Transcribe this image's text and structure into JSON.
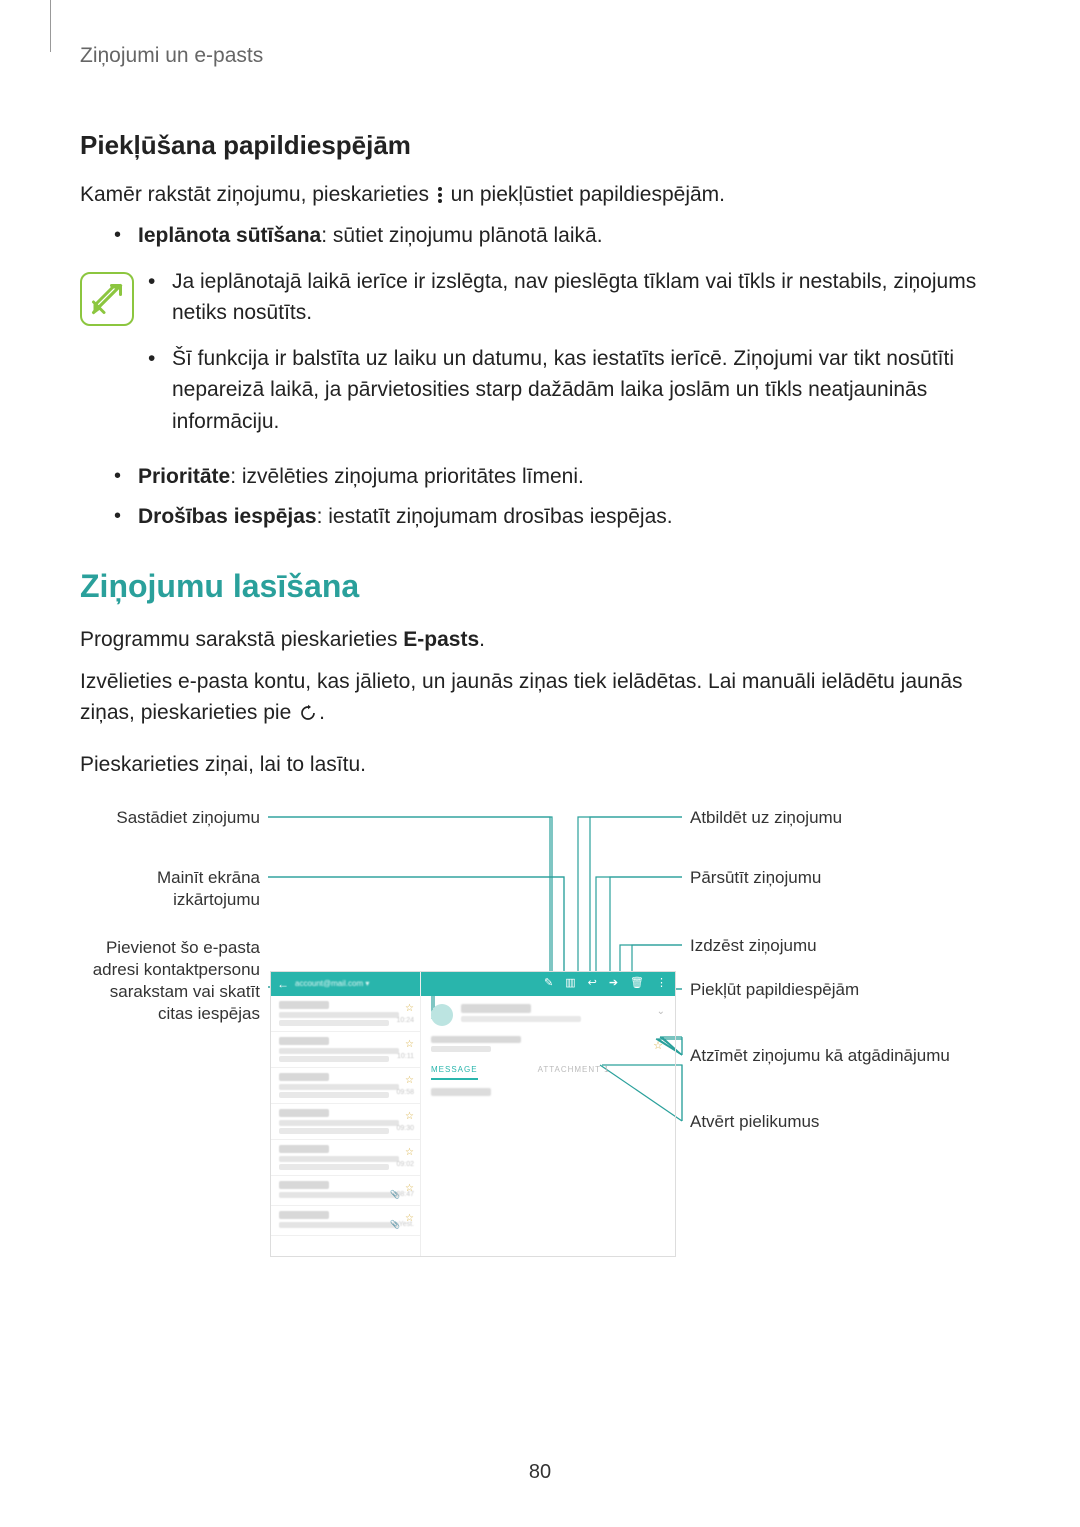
{
  "breadcrumb": "Ziņojumi un e-pasts",
  "section1": {
    "heading": "Piekļūšana papildiespējām",
    "intro_before": "Kamēr rakstāt ziņojumu, pieskarieties ",
    "intro_after": " un piekļūstiet papildiespējām.",
    "bullets": [
      {
        "bold": "Ieplānota sūtīšana",
        "text": ": sūtiet ziņojumu plānotā laikā."
      }
    ],
    "note": [
      "Ja ieplānotajā laikā ierīce ir izslēgta, nav pieslēgta tīklam vai tīkls ir nestabils, ziņojums netiks nosūtīts.",
      "Šī funkcija ir balstīta uz laiku un datumu, kas iestatīts ierīcē. Ziņojumi var tikt nosūtīti nepareizā laikā, ja pārvietosities starp dažādām laika joslām un tīkls neatjauninās informāciju."
    ],
    "bullets2": [
      {
        "bold": "Prioritāte",
        "text": ": izvēlēties ziņojuma prioritātes līmeni."
      },
      {
        "bold": "Drošības iespējas",
        "text": ": iestatīt ziņojumam drosības iespējas."
      }
    ]
  },
  "section2": {
    "heading": "Ziņojumu lasīšana",
    "p1_before": "Programmu sarakstā pieskarieties ",
    "p1_bold": "E-pasts",
    "p1_after": ".",
    "p2_before": "Izvēlieties e-pasta kontu, kas jālieto, un jaunās ziņas tiek ielādētas. Lai manuāli ielādētu jaunās ziņas, pieskarieties pie ",
    "p2_after": ".",
    "p3": "Pieskarieties ziņai, lai to lasītu."
  },
  "callouts": {
    "left": [
      "Sastādiet ziņojumu",
      "Mainīt ekrāna izkārtojumu",
      "Pievienot šo e-pasta adresi kontaktpersonu sarakstam vai skatīt citas iespējas"
    ],
    "right": [
      "Atbildēt uz ziņojumu",
      "Pārsūtīt ziņojumu",
      "Izdzēst ziņojumu",
      "Piekļūt papildiespējām",
      "Atzīmēt ziņojumu kā atgādinājumu",
      "Atvērt pielikumus"
    ]
  },
  "phone": {
    "tab_active": "MESSAGE",
    "tab_other": "ATTACHMENT 1"
  },
  "page_number": "80"
}
